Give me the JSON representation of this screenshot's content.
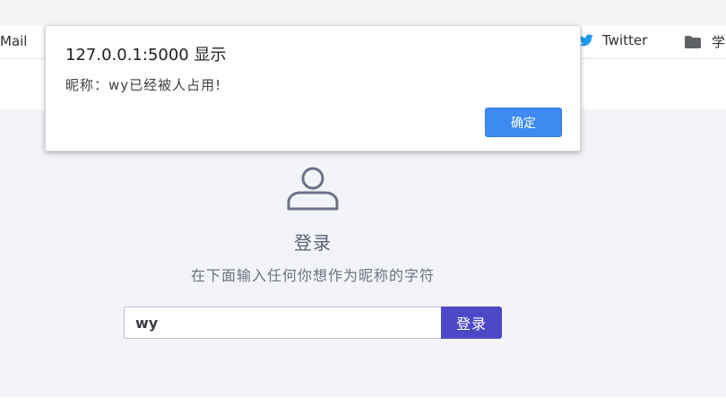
{
  "bookmarks": {
    "mail_label": "Mail",
    "twitter_label": "Twitter",
    "folder_label": "学"
  },
  "login": {
    "title": "登录",
    "subtitle": "在下面输入任何你想作为昵称的字符",
    "nickname_value": "wy",
    "button_label": "登录"
  },
  "dialog": {
    "title": "127.0.0.1:5000 显示",
    "message": "昵称：wy已经被人占用!",
    "ok_label": "确定"
  },
  "colors": {
    "accent": "#4d49c6",
    "dialog_button": "#3d8bf0",
    "twitter_blue": "#1d9bf0",
    "panel_bg": "#f3f4f7"
  }
}
